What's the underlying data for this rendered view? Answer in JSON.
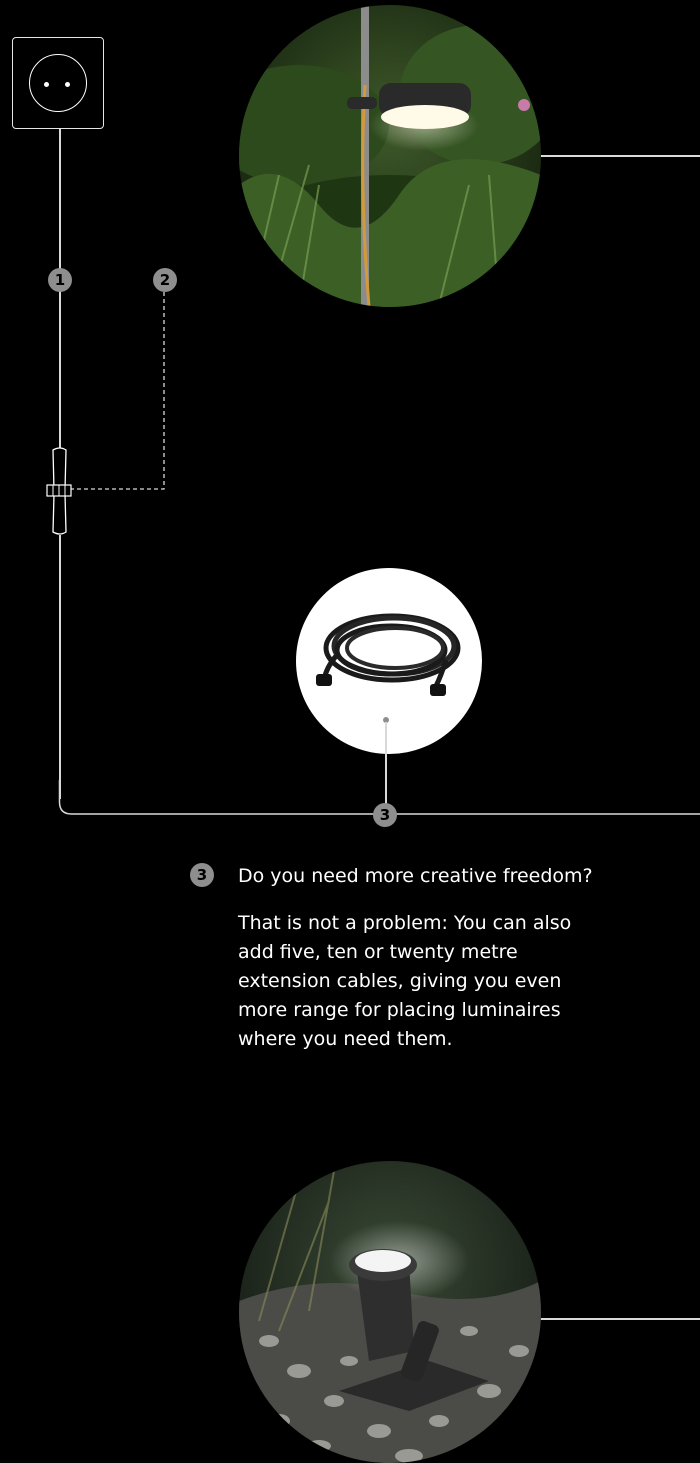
{
  "socket": {
    "icon": "power-socket-icon"
  },
  "badges": {
    "one": "1",
    "two": "2",
    "three": "3"
  },
  "images": {
    "top": "garden-pole-light",
    "cable": "extension-cable",
    "bottom": "garden-spot-light"
  },
  "info": {
    "badge": "3",
    "heading": "Do you need more creative freedom?",
    "body": "That is not a problem: You can also add five, ten or twenty metre extension cables, giving you even more range for placing luminaires where you need them."
  },
  "colors": {
    "background": "#000000",
    "line": "#d9d9d9",
    "badge": "#8e8e8e"
  }
}
